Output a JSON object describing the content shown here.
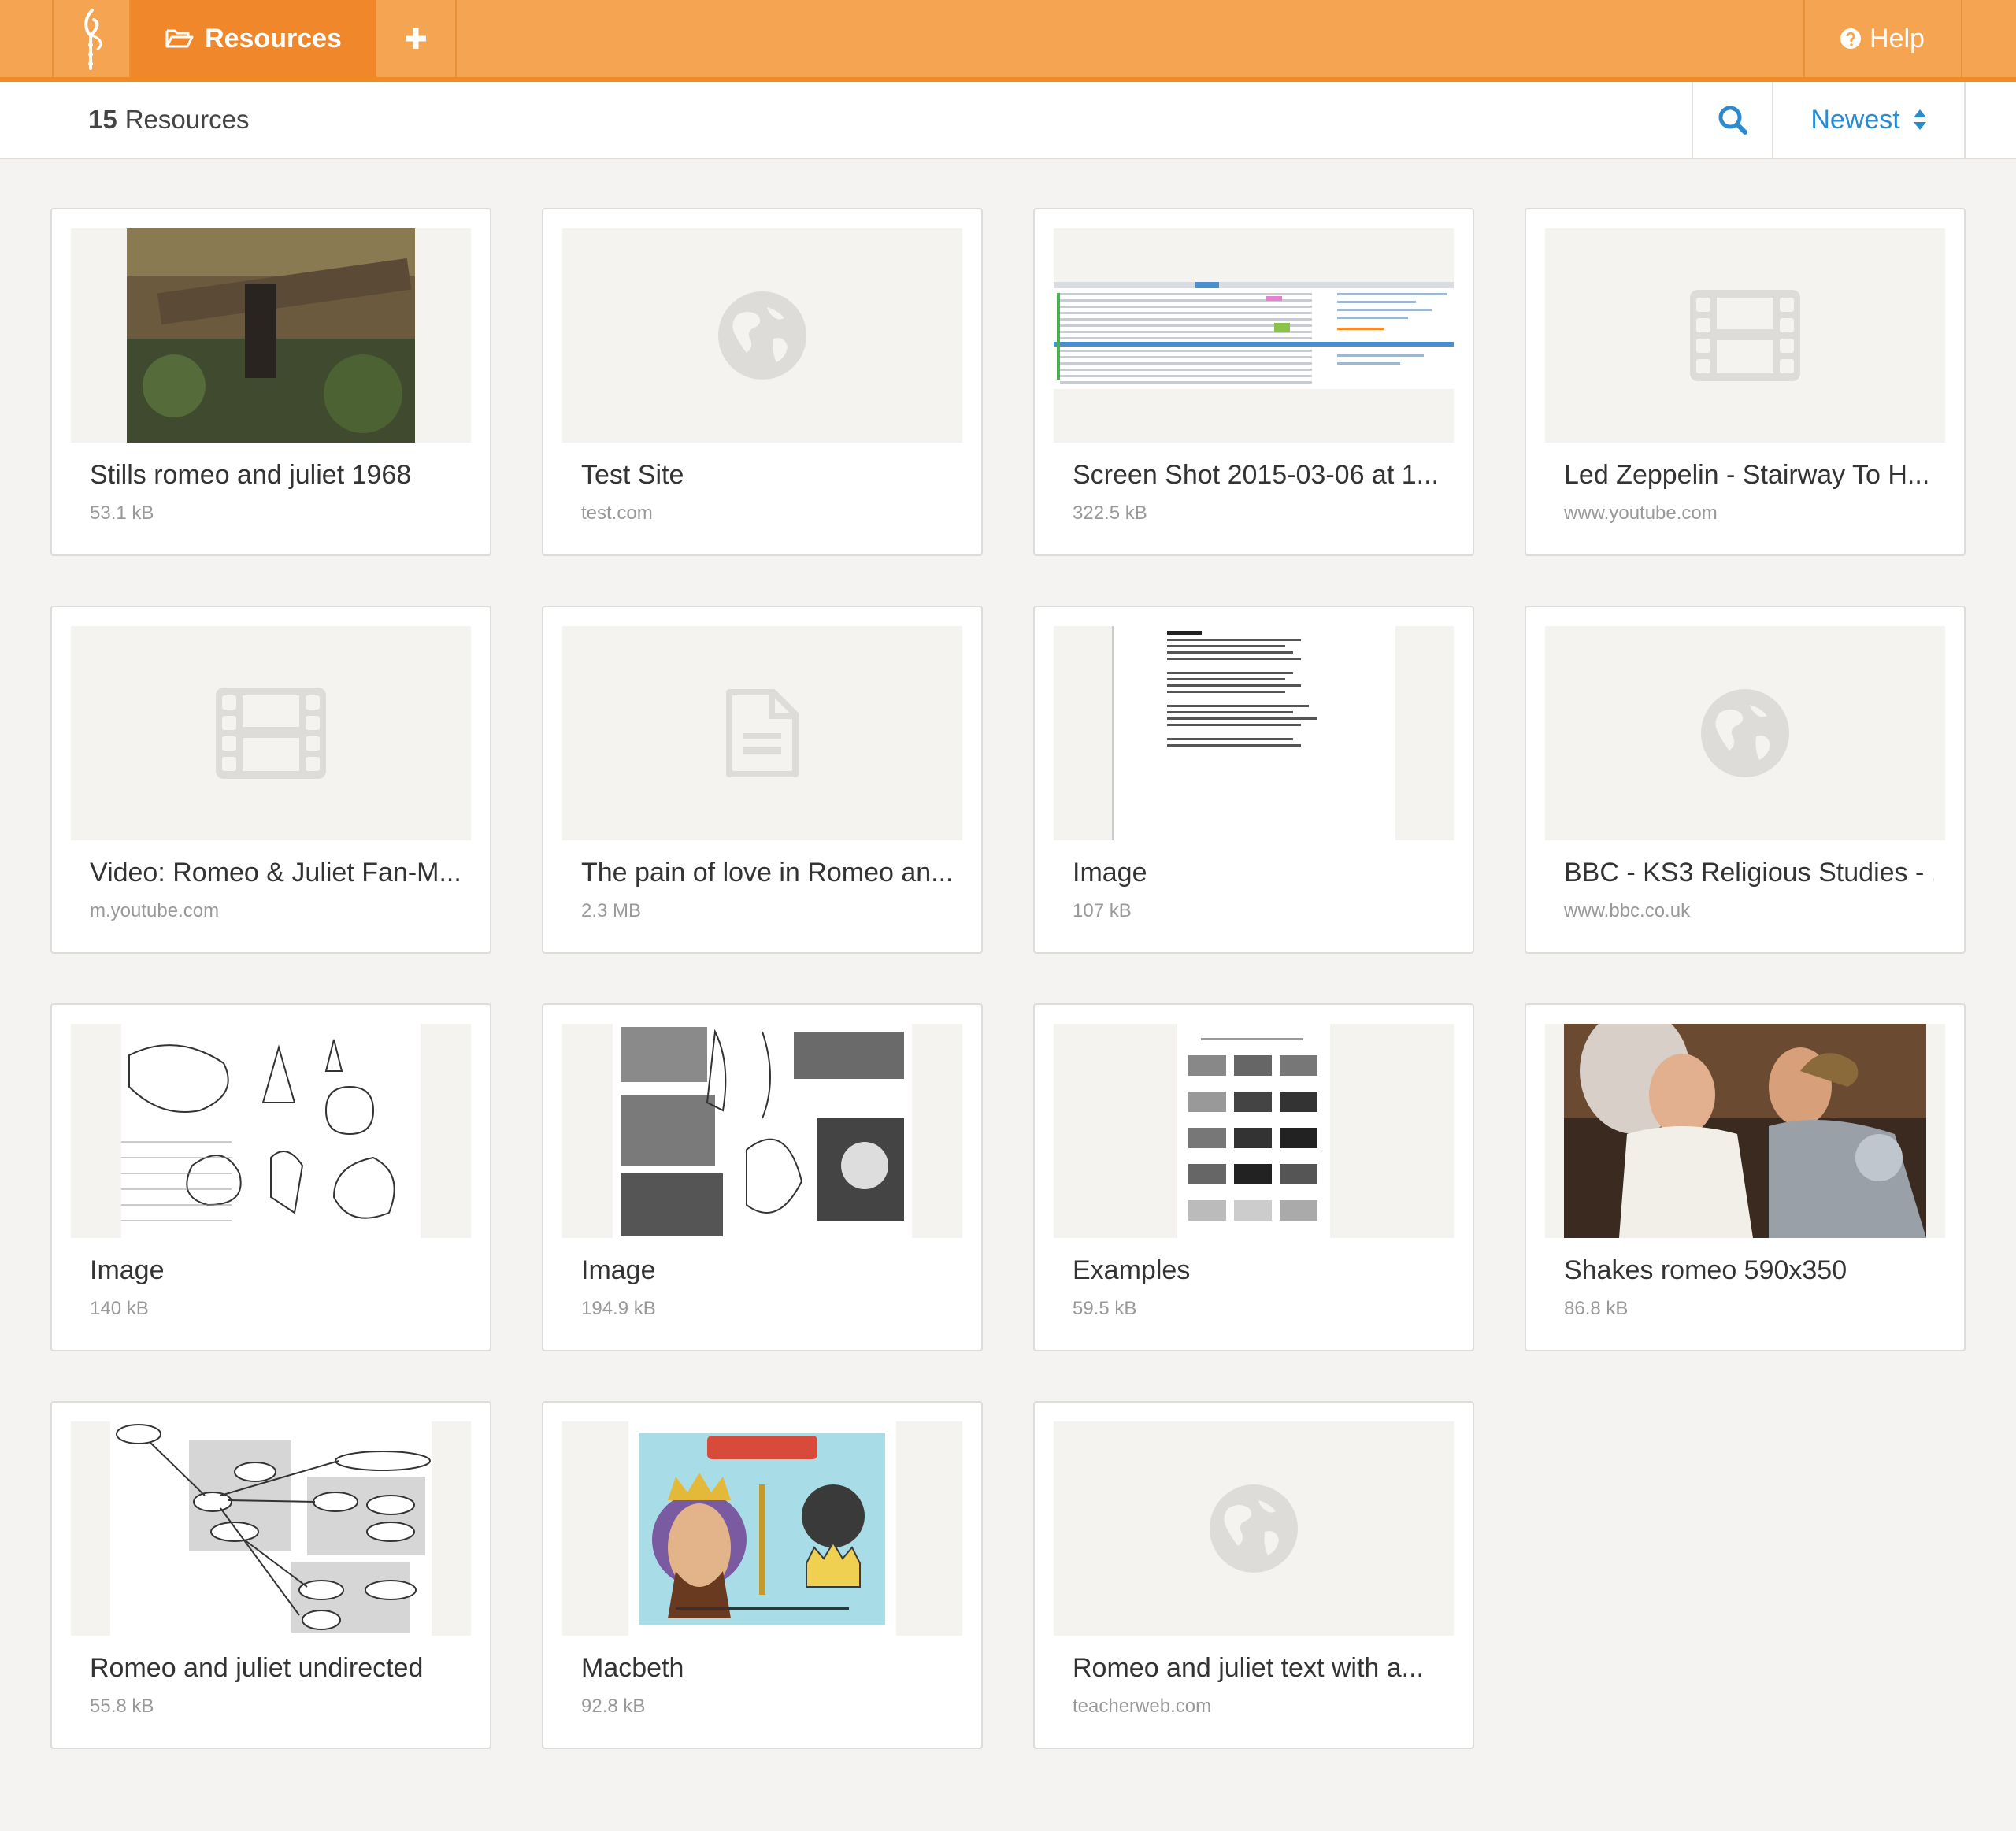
{
  "nav": {
    "tab_label": "Resources",
    "help_label": "Help"
  },
  "toolbar": {
    "count": "15",
    "count_label": "Resources",
    "sort_label": "Newest"
  },
  "colors": {
    "brand_orange": "#f5a452",
    "active_tab": "#f0872a",
    "accent_blue": "#2a8ccf"
  },
  "resources": [
    {
      "title": "Stills romeo and juliet 1968",
      "meta": "53.1 kB",
      "thumb": "photo"
    },
    {
      "title": "Test Site",
      "meta": "test.com",
      "thumb": "globe-icon"
    },
    {
      "title": "Screen Shot 2015-03-06 at 1...",
      "meta": "322.5 kB",
      "thumb": "screenshot"
    },
    {
      "title": "Led Zeppelin - Stairway To H...",
      "meta": "www.youtube.com",
      "thumb": "film-icon"
    },
    {
      "title": "Video: Romeo & Juliet Fan-M...",
      "meta": "m.youtube.com",
      "thumb": "film-icon"
    },
    {
      "title": "The pain of love in Romeo an...",
      "meta": "2.3 MB",
      "thumb": "document-icon"
    },
    {
      "title": "Image",
      "meta": "107 kB",
      "thumb": "text-page"
    },
    {
      "title": "BBC - KS3 Religious Studies - ...",
      "meta": "www.bbc.co.uk",
      "thumb": "globe-icon"
    },
    {
      "title": "Image",
      "meta": "140 kB",
      "thumb": "shells-sketch"
    },
    {
      "title": "Image",
      "meta": "194.9 kB",
      "thumb": "textures-sketch"
    },
    {
      "title": "Examples",
      "meta": "59.5 kB",
      "thumb": "hatching-chart"
    },
    {
      "title": "Shakes romeo 590x350",
      "meta": "86.8 kB",
      "thumb": "photo"
    },
    {
      "title": "Romeo and juliet undirected",
      "meta": "55.8 kB",
      "thumb": "diagram"
    },
    {
      "title": "Macbeth",
      "meta": "92.8 kB",
      "thumb": "illustration"
    },
    {
      "title": "Romeo and juliet text with a...",
      "meta": "teacherweb.com",
      "thumb": "globe-icon"
    }
  ]
}
